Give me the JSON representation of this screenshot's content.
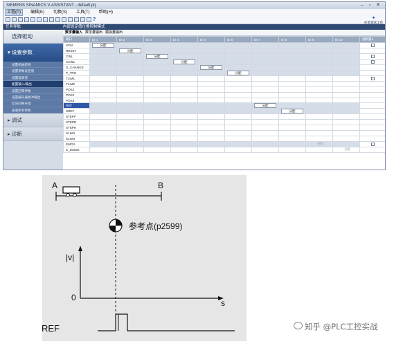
{
  "window": {
    "title": "SIEMENS SINAMICS V-ASSISTANT - default.prj",
    "controls": "– ▫ ✕"
  },
  "menu": [
    "工程(P)",
    "编辑(E)",
    "切换(S)",
    "工具(T)",
    "帮助(H)"
  ],
  "toolbar": {
    "right_label": "在近调试工作"
  },
  "nav": {
    "title": "任务导航",
    "mode": "内部设定值位置控制模式"
  },
  "sidebar": {
    "top": "选择驱动",
    "active": "设置参数",
    "subitems": [
      "设置机械结构",
      "设置参数设定值",
      "设置极限值",
      "配置输入/输出",
      "设置回零参数",
      "设置编码器脉冲输出",
      "反向间隙补偿",
      "查看所有参数"
    ],
    "selected_index": 3,
    "bottom": [
      "调试",
      "诊断"
    ]
  },
  "subtabs": [
    "数字量输入",
    "数字量输出",
    "模拟量输出"
  ],
  "table": {
    "columns": [
      "端口",
      "DI 1",
      "DI 2",
      "DI 3",
      "DI 4",
      "DI 5",
      "DI 6",
      "DI 7",
      "DI 8",
      "DI 9",
      "DI 10",
      "强制置1"
    ],
    "assign_label": "分配",
    "rows": [
      {
        "name": "SON",
        "a": 1,
        "cb": true,
        "shade": true
      },
      {
        "name": "RESET",
        "a": 2,
        "cb": false,
        "shade": true
      },
      {
        "name": "CWL",
        "a": 3,
        "cb": true,
        "shade": true
      },
      {
        "name": "CCWL",
        "a": 4,
        "cb": true,
        "shade": true
      },
      {
        "name": "G_CHANGE",
        "a": 5,
        "cb": false,
        "shade": true
      },
      {
        "name": "P_TRG",
        "a": 6,
        "cb": false,
        "shade": true
      },
      {
        "name": "TLIM1",
        "a": 0,
        "cb": true,
        "shade": false
      },
      {
        "name": "TLIM2",
        "a": 0,
        "cb": false,
        "shade": false
      },
      {
        "name": "POS1",
        "a": 0,
        "cb": false,
        "shade": false
      },
      {
        "name": "POS2",
        "a": 0,
        "cb": false,
        "shade": false
      },
      {
        "name": "POS3",
        "a": 0,
        "cb": false,
        "shade": false
      },
      {
        "name": "REF",
        "a": 7,
        "cb": false,
        "shade": true,
        "sel": true
      },
      {
        "name": "SREF",
        "a": 8,
        "cb": false,
        "shade": true
      },
      {
        "name": "STEPF",
        "a": 0,
        "cb": false,
        "shade": false
      },
      {
        "name": "STEPB",
        "a": 0,
        "cb": false,
        "shade": false
      },
      {
        "name": "STEPH",
        "a": 0,
        "cb": false,
        "shade": false
      },
      {
        "name": "SLIM1",
        "a": 0,
        "cb": false,
        "shade": false
      },
      {
        "name": "SLIM2",
        "a": 0,
        "cb": false,
        "shade": false
      },
      {
        "name": "EMGS",
        "a": 0,
        "cb": true,
        "shade": true,
        "dis": 9
      },
      {
        "name": "C_MODE",
        "a": 0,
        "cb": false,
        "shade": false,
        "dis": 10
      }
    ]
  },
  "diagram": {
    "point_a": "A",
    "point_b": "B",
    "ref_point": "参考点(p2599)",
    "y_axis": "|v|",
    "zero": "0",
    "x_axis": "s",
    "signal": "REF"
  },
  "watermark": "知乎 @PLC工控实战"
}
